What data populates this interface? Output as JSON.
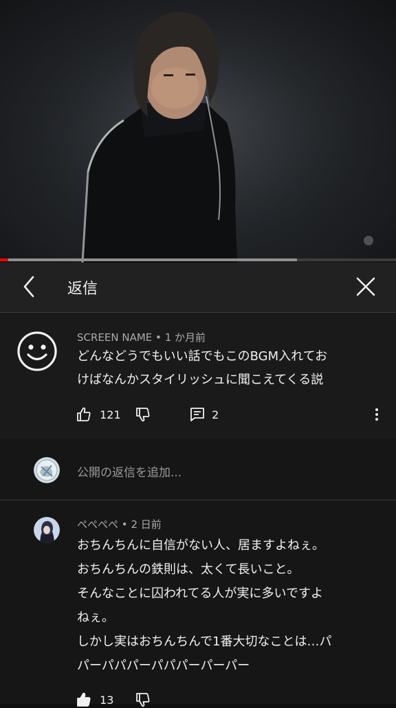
{
  "player": {
    "progress": 0.02,
    "buffered": 0.75
  },
  "header": {
    "title": "返信"
  },
  "parent_comment": {
    "author": "SCREEN NAME",
    "separator": "•",
    "time": "1 か月前",
    "lines": [
      "どんなどうでもいい話でもこのBGM入れてお",
      "けばなんかスタイリッシュに聞こえてくる説"
    ],
    "likes": "121",
    "replies": "2",
    "icons": {
      "like": "thumbs-up-icon",
      "dislike": "thumbs-down-icon",
      "reply": "comment-icon",
      "more": "more-vert-icon"
    }
  },
  "compose": {
    "placeholder": "公開の返信を追加..."
  },
  "reply": {
    "author": "ぺぺぺぺ",
    "separator": "•",
    "time": "2 日前",
    "lines": [
      "おちんちんに自信がない人、居ますよねぇ。",
      "おちんちんの鉄則は、太くて長いこと。",
      "そんなことに囚われてる人が実に多いですよ",
      "ねぇ。",
      "しかし実はおちんちんで1番大切なことは…パ",
      "パーパパパーパパパーパーパー"
    ],
    "likes": "13"
  },
  "colors": {
    "progress": "#ff0000",
    "background": "#0f0f0f",
    "header": "#212121",
    "parent_bg": "#1a1a1a"
  }
}
